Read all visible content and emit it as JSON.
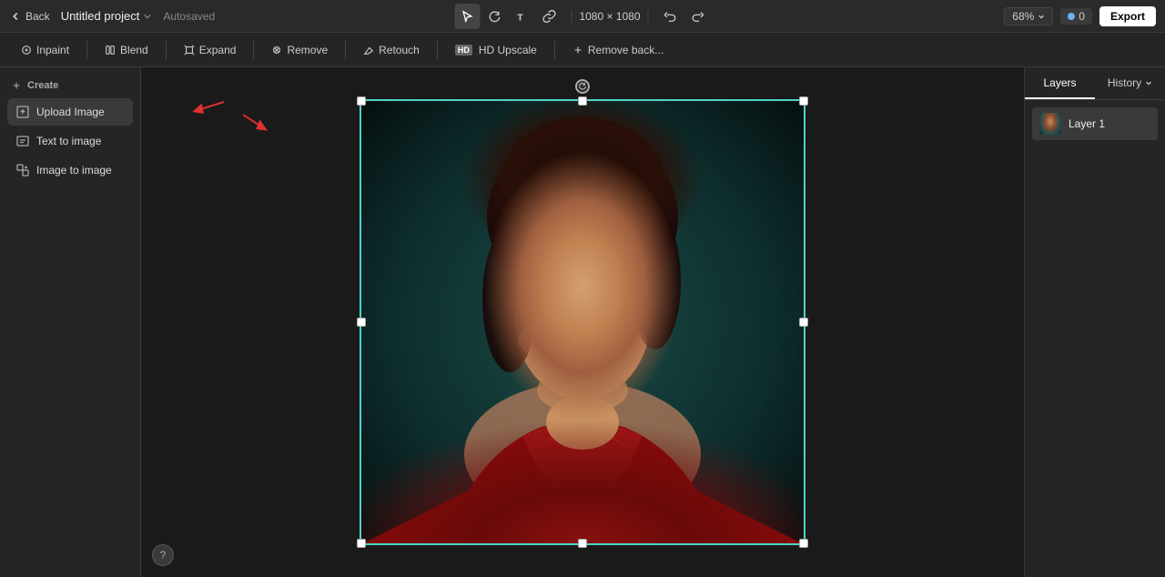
{
  "topbar": {
    "back_label": "Back",
    "project_title": "Untitled project",
    "autosaved": "Autosaved",
    "dimensions": "1080 × 1080",
    "zoom_label": "68%",
    "user_count": "0",
    "export_label": "Export"
  },
  "toolbar": {
    "inpaint_label": "Inpaint",
    "blend_label": "Blend",
    "expand_label": "Expand",
    "remove_label": "Remove",
    "retouch_label": "Retouch",
    "hd_upscale_label": "HD Upscale",
    "remove_back_label": "Remove back..."
  },
  "sidebar": {
    "create_label": "Create",
    "items": [
      {
        "id": "upload-image",
        "label": "Upload Image"
      },
      {
        "id": "text-to-image",
        "label": "Text to image"
      },
      {
        "id": "image-to-image",
        "label": "Image to image"
      }
    ]
  },
  "right_panel": {
    "layers_tab": "Layers",
    "history_tab": "History",
    "layer1_name": "Layer 1"
  },
  "help_label": "?"
}
